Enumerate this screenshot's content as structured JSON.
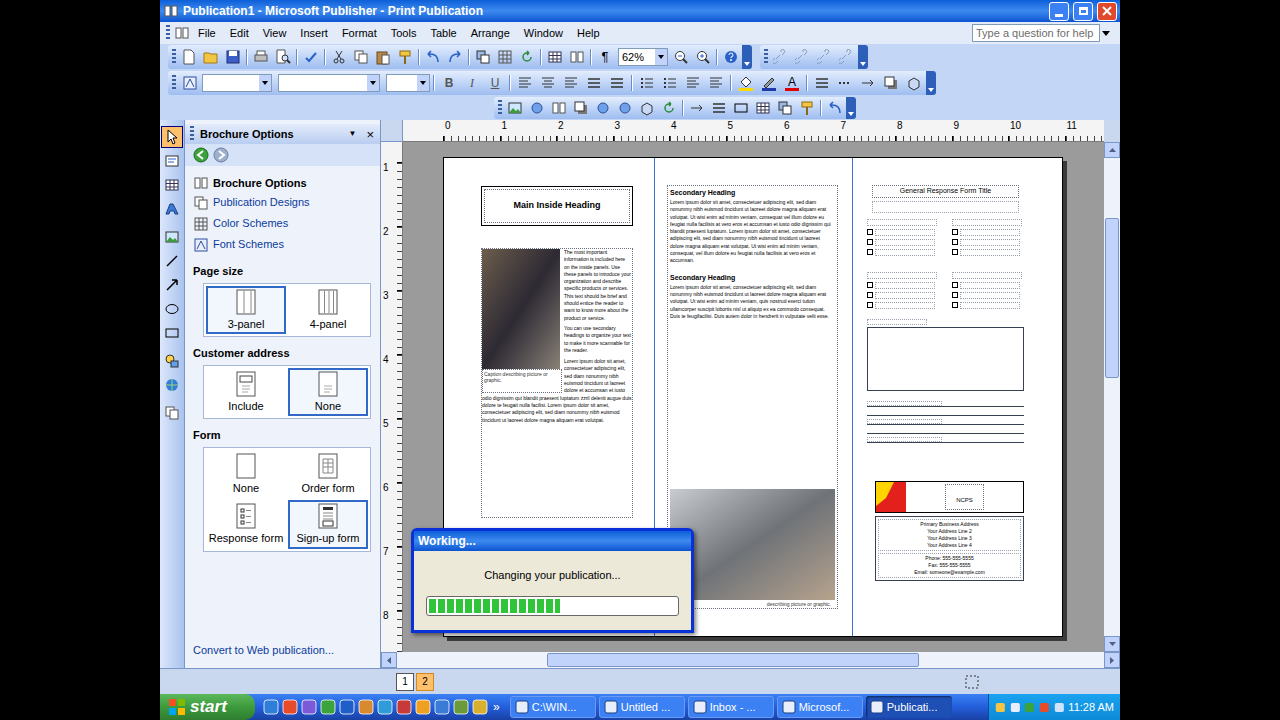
{
  "window": {
    "title": "Publication1 - Microsoft Publisher - Print Publication"
  },
  "menu": [
    "File",
    "Edit",
    "View",
    "Insert",
    "Format",
    "Tools",
    "Table",
    "Arrange",
    "Window",
    "Help"
  ],
  "help_box": {
    "placeholder": "Type a question for help"
  },
  "standard_toolbar": {
    "formatting_marks": "¶",
    "zoom": "62%"
  },
  "formatting_toolbar": {
    "bold": "B",
    "italic": "I",
    "underline": "U",
    "font_color": "A"
  },
  "task_pane": {
    "title": "Brochure Options",
    "menu_glyph": "▼",
    "close_glyph": "×",
    "heading": "Brochure Options",
    "links": [
      "Publication Designs",
      "Color Schemes",
      "Font Schemes"
    ],
    "sections": [
      {
        "title": "Page size",
        "options": [
          {
            "label": "3-panel",
            "kind": "panel3",
            "selected": true
          },
          {
            "label": "4-panel",
            "kind": "panel4",
            "selected": false
          }
        ]
      },
      {
        "title": "Customer address",
        "options": [
          {
            "label": "Include",
            "kind": "include",
            "selected": false
          },
          {
            "label": "None",
            "kind": "blank",
            "selected": true
          }
        ]
      },
      {
        "title": "Form",
        "options": [
          {
            "label": "None",
            "kind": "plain",
            "selected": false
          },
          {
            "label": "Order form",
            "kind": "order",
            "selected": false
          },
          {
            "label": "Response form",
            "kind": "response",
            "selected": false
          },
          {
            "label": "Sign-up form",
            "kind": "signup",
            "selected": true
          }
        ]
      }
    ],
    "footer": "Convert to Web publication..."
  },
  "rulers": {
    "horizontal": [
      "0",
      "1",
      "2",
      "3",
      "4",
      "5",
      "6",
      "7",
      "8",
      "9",
      "10",
      "11"
    ],
    "vertical": [
      "1",
      "2",
      "3",
      "4",
      "5",
      "6",
      "7",
      "8"
    ]
  },
  "page": {
    "panel1": {
      "heading": "Main Inside Heading",
      "intro": "The most important information is included here on the inside panels. Use these panels to introduce your organization and describe specific products or services. This text should be brief and should entice the reader to want to know more about the product or service.",
      "tip": "You can use secondary headings to organize your text to make it more scannable for the reader.",
      "body": "Lorem ipsum dolor sit amet, consectetuer adipiscing elit, sed diam nonummy nibh euismod tincidunt ut laoreet dolore et accumsan et iusto odio dignissim qui blandit praesent luptatum zzril delenit augue duis dolore te feugait nulla facilisi. Lorem ipsum dolor sit amet, consectetuer adipiscing elit, sed diam nonummy nibh euismod tincidunt ut laoreet dolore magna aliquam erat volutpat.",
      "caption": "Caption describing picture or graphic."
    },
    "panel2": {
      "sections": [
        {
          "heading": "Secondary Heading",
          "body": "Lorem ipsum dolor sit amet, consectetuer adipiscing elit, sed diam nonummy nibh euismod tincidunt ut laoreet dolore magna aliquam erat volutpat. Ut wisi enim ad minim veniam, consequat vel illum dolore eu feugiat nulla facilisis at vero eros et accumsan et iusto odio dignissim qui blandit praesent luptatum. Lorem ipsum dolor sit amet, consectetuer adipiscing elit, sed diam nonummy nibh euismod tincidunt ut laoreet dolore magna aliquam erat volutpat. Ut wisi enim ad minim veniam, consequat, vel illum dolore eu feugiat nulla facilisis at vero eros et accumsan."
        },
        {
          "heading": "Secondary Heading",
          "body": "Lorem ipsum dolor sit amet, consectetuer adipiscing elit, sed diam nonummy nibh euismod tincidunt ut laoreet dolore magna aliquam erat volutpat. Ut wisi enim ad minim veniam, quis nostrud exerci tution ullamcorper suscipit lobortis nisl ut aliquip ex ea commodo consequat. Duis te feugifacilisi. Duis autem dolor in hendrerit in vulputate velit esse."
        }
      ],
      "caption": "describing picture or graphic."
    },
    "panel3": {
      "form_title": "General Response Form Title",
      "response_groups": [
        {
          "checkboxes": [
            {
              "checked": false
            },
            {
              "checked": false
            },
            {
              "checked": false
            }
          ]
        },
        {
          "checkboxes": [
            {
              "checked": false
            },
            {
              "checked": false
            },
            {
              "checked": false
            }
          ]
        },
        {
          "checkboxes": [
            {
              "checked": false
            },
            {
              "checked": false
            },
            {
              "checked": false
            }
          ]
        },
        {
          "checkboxes": [
            {
              "checked": false
            },
            {
              "checked": false
            },
            {
              "checked": false
            }
          ]
        }
      ],
      "logo": "NCPS",
      "address": [
        "Primary Business Address",
        "Your Address Line 2",
        "Your Address Line 3",
        "Your Address Line 4"
      ],
      "contact": [
        "Phone: 555-555-5555",
        "Fax: 555-555-5555",
        "Email: someone@example.com"
      ]
    }
  },
  "dialog": {
    "title": "Working...",
    "message": "Changing your publication...",
    "level": 0.53
  },
  "page_navigator": [
    {
      "label": "1",
      "selected": false
    },
    {
      "label": "2",
      "selected": true
    }
  ],
  "taskbar": {
    "start": "start",
    "quick_launch_more": "»",
    "buttons": [
      {
        "label": "C:\\WIN...",
        "selected": false
      },
      {
        "label": "Untitled ...",
        "selected": false
      },
      {
        "label": "Inbox - ...",
        "selected": false
      },
      {
        "label": "Microsof...",
        "selected": false
      },
      {
        "label": "Publicati...",
        "selected": true
      }
    ],
    "clock": "11:28 AM"
  }
}
